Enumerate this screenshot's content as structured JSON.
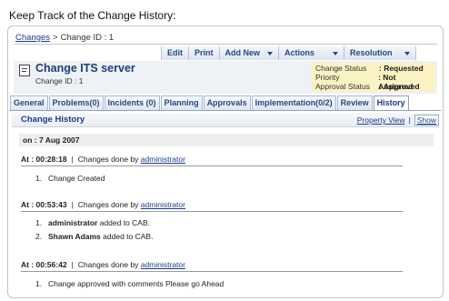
{
  "caption": "Keep Track of the Change History:",
  "breadcrumb": {
    "root": "Changes",
    "separator": ">",
    "current": "Change ID : 1"
  },
  "toolbar": {
    "edit": "Edit",
    "print": "Print",
    "add_new": "Add New",
    "actions": "Actions",
    "resolution": "Resolution"
  },
  "request": {
    "title": "Change ITS server",
    "id": "Change ID : 1",
    "status": [
      {
        "label": "Change Status",
        "value": ": Requested"
      },
      {
        "label": "Priority",
        "value": ": Not Assigned"
      },
      {
        "label": "Approval Status",
        "value": ": Approved"
      }
    ]
  },
  "tabs": [
    {
      "label": "General"
    },
    {
      "label": "Problems(0)"
    },
    {
      "label": "Incidents (0)"
    },
    {
      "label": "Planning"
    },
    {
      "label": "Approvals"
    },
    {
      "label": "Implementation(0/2)"
    },
    {
      "label": "Review"
    },
    {
      "label": "History",
      "active": true
    }
  ],
  "history": {
    "title": "Change History",
    "property_view": "Property View",
    "links_separator": "|",
    "show": "Show",
    "on_label": "on : 7 Aug 2007",
    "changes_done_by": "Changes done by",
    "entries": [
      {
        "at": "At : 00:28:18",
        "user": "administrator",
        "items": [
          {
            "num": "1.",
            "actor": "",
            "text": "Change Created"
          }
        ]
      },
      {
        "at": "At : 00:53:43",
        "user": "administrator",
        "items": [
          {
            "num": "1.",
            "actor": "administrator",
            "text": " added to CAB."
          },
          {
            "num": "2.",
            "actor": "Shawn Adams",
            "text": " added to CAB."
          }
        ]
      },
      {
        "at": "At : 00:56:42",
        "user": "administrator",
        "items": [
          {
            "num": "1.",
            "actor": "",
            "text": "Change approved with comments Please go Ahead"
          }
        ]
      }
    ]
  },
  "colors": {
    "link": "#1a3c8a",
    "status_box": "#fbf2c4",
    "tab_border": "#8fa3bf"
  },
  "icons": {
    "request": "change-request-icon",
    "dropdown": "chevron-down-icon"
  }
}
